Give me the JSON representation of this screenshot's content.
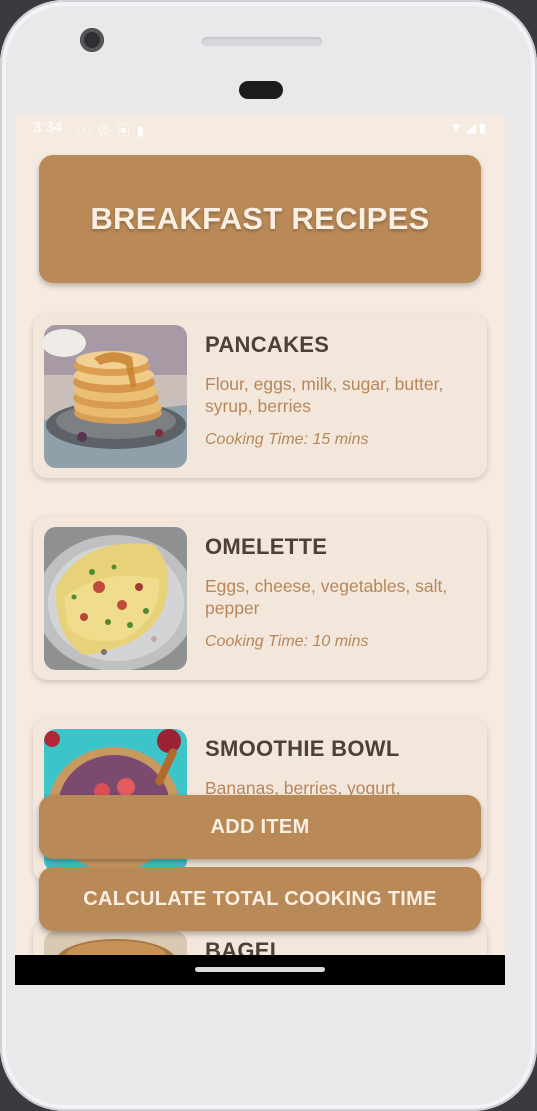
{
  "status_bar": {
    "time": "3:34",
    "left_icons": [
      "info-icon",
      "no-disturb-icon",
      "translate-icon",
      "sd-card-icon"
    ],
    "right_icons": [
      "wifi-icon",
      "signal-icon",
      "battery-icon"
    ]
  },
  "header": {
    "title": "BREAKFAST RECIPES"
  },
  "recipes": [
    {
      "title": "PANCAKES",
      "ingredients": "Flour, eggs, milk, sugar, butter, syrup, berries",
      "time": "Cooking Time: 15 mins"
    },
    {
      "title": "OMELETTE",
      "ingredients": "Eggs, cheese, vegetables, salt, pepper",
      "time": "Cooking Time: 10 mins"
    },
    {
      "title": "SMOOTHIE BOWL",
      "ingredients": "Bananas, berries, yogurt,",
      "time": ""
    },
    {
      "title": "BAGEL",
      "ingredients": "",
      "time": ""
    }
  ],
  "buttons": {
    "add_item": "ADD ITEM",
    "calculate": "CALCULATE TOTAL COOKING TIME"
  },
  "colors": {
    "accent": "#b98a57",
    "background": "#f6ebe1",
    "card": "#f3e7dc",
    "title_text": "#4e4038",
    "body_text": "#b7875a"
  }
}
